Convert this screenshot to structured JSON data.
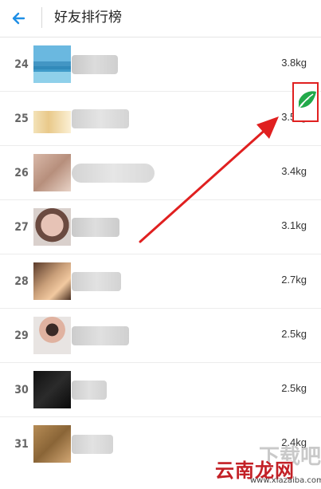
{
  "header": {
    "title": "好友排行榜",
    "back_icon": "arrow-left-icon",
    "accent_color": "#1f8fe6"
  },
  "rows": [
    {
      "rank": "24",
      "weight": "3.8kg"
    },
    {
      "rank": "25",
      "weight": "3.5kg"
    },
    {
      "rank": "26",
      "weight": "3.4kg"
    },
    {
      "rank": "27",
      "weight": "3.1kg"
    },
    {
      "rank": "28",
      "weight": "2.7kg"
    },
    {
      "rank": "29",
      "weight": "2.5kg"
    },
    {
      "rank": "30",
      "weight": "2.5kg"
    },
    {
      "rank": "31",
      "weight": "2.4kg"
    }
  ],
  "highlight": {
    "icon": "leaf-icon",
    "box_color": "#e02020",
    "arrow_color": "#e02020",
    "leaf_color": "#22a94a"
  },
  "watermark": {
    "brand": "云南龙网",
    "url": "www.xiazaiba.com"
  }
}
